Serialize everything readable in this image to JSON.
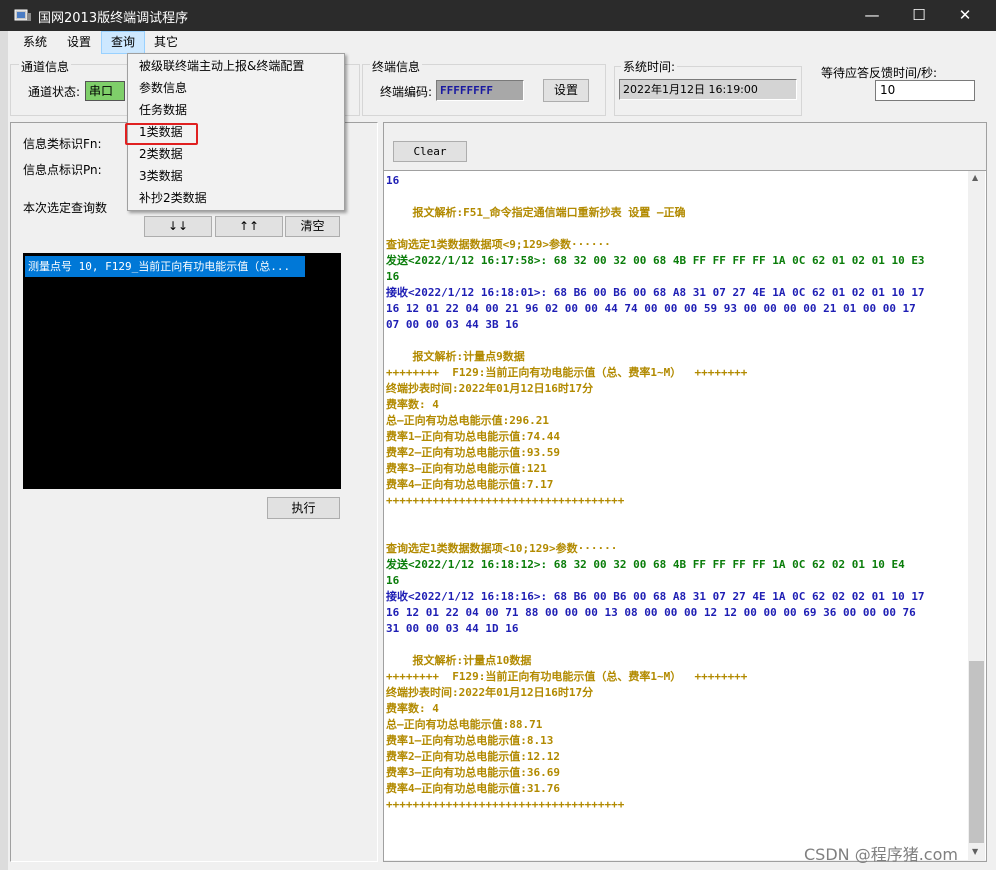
{
  "window": {
    "title": "国网2013版终端调试程序",
    "minimize": "—",
    "maximize": "☐",
    "close": "✕"
  },
  "menu": {
    "items": [
      "系统",
      "设置",
      "查询",
      "其它"
    ],
    "active": "查询",
    "dropdown": [
      "被级联终端主动上报&终端配置",
      "参数信息",
      "任务数据",
      "1类数据",
      "2类数据",
      "3类数据",
      "补抄2类数据"
    ],
    "highlighted": "1类数据"
  },
  "channel": {
    "group_label": "通道信息",
    "status_label": "通道状态:",
    "status_value": "串口"
  },
  "terminal": {
    "group_label": "终端信息",
    "code_label": "终端编码:",
    "code_value": "FFFFFFFF",
    "set_button": "设置"
  },
  "systime": {
    "group_label": "系统时间:",
    "value": "2022年1月12日  16:19:00"
  },
  "wait": {
    "label": "等待应答反馈时间/秒:",
    "value": "10"
  },
  "query": {
    "fn_label": "信息类标识Fn:",
    "pn_label": "信息点标识Pn:",
    "selected_label": "本次选定查询数",
    "btn_down": "↓↓",
    "btn_up": "↑↑",
    "btn_clear": "清空",
    "list_item": "测量点号 10, F129_当前正向有功电能示值（总...",
    "btn_exec": "执行"
  },
  "log": {
    "clear_button": "Clear",
    "lines": [
      {
        "t": "16",
        "c": "blue"
      },
      {
        "t": "",
        "c": "gold"
      },
      {
        "t": "    报文解析:F51_命令指定通信端口重新抄表 设置 —正确",
        "c": "gold"
      },
      {
        "t": "",
        "c": "gold"
      },
      {
        "t": "查询选定1类数据数据项<9;129>参数······",
        "c": "gold"
      },
      {
        "t": "发送<2022/1/12 16:17:58>: 68 32 00 32 00 68 4B FF FF FF FF 1A 0C 62 01 02 01 10 E3",
        "c": "green"
      },
      {
        "t": "16",
        "c": "green"
      },
      {
        "t": "接收<2022/1/12 16:18:01>: 68 B6 00 B6 00 68 A8 31 07 27 4E 1A 0C 62 01 02 01 10 17",
        "c": "blue"
      },
      {
        "t": "16 12 01 22 04 00 21 96 02 00 00 44 74 00 00 00 59 93 00 00 00 00 21 01 00 00 17",
        "c": "blue"
      },
      {
        "t": "07 00 00 03 44 3B 16",
        "c": "blue"
      },
      {
        "t": "",
        "c": "gold"
      },
      {
        "t": "    报文解析:计量点9数据",
        "c": "gold"
      },
      {
        "t": "++++++++  F129:当前正向有功电能示值（总、费率1~M）  ++++++++",
        "c": "gold"
      },
      {
        "t": "终端抄表时间:2022年01月12日16时17分",
        "c": "gold"
      },
      {
        "t": "费率数: 4",
        "c": "gold"
      },
      {
        "t": "总—正向有功总电能示值:296.21",
        "c": "gold"
      },
      {
        "t": "费率1—正向有功总电能示值:74.44",
        "c": "gold"
      },
      {
        "t": "费率2—正向有功总电能示值:93.59",
        "c": "gold"
      },
      {
        "t": "费率3—正向有功总电能示值:121",
        "c": "gold"
      },
      {
        "t": "费率4—正向有功总电能示值:7.17",
        "c": "gold"
      },
      {
        "t": "++++++++++++++++++++++++++++++++++++",
        "c": "gold"
      },
      {
        "t": "",
        "c": "gold"
      },
      {
        "t": "",
        "c": "gold"
      },
      {
        "t": "查询选定1类数据数据项<10;129>参数······",
        "c": "gold"
      },
      {
        "t": "发送<2022/1/12 16:18:12>: 68 32 00 32 00 68 4B FF FF FF FF 1A 0C 62 02 01 10 E4",
        "c": "green"
      },
      {
        "t": "16",
        "c": "green"
      },
      {
        "t": "接收<2022/1/12 16:18:16>: 68 B6 00 B6 00 68 A8 31 07 27 4E 1A 0C 62 02 02 01 10 17",
        "c": "blue"
      },
      {
        "t": "16 12 01 22 04 00 71 88 00 00 00 13 08 00 00 00 12 12 00 00 00 69 36 00 00 00 76",
        "c": "blue"
      },
      {
        "t": "31 00 00 03 44 1D 16",
        "c": "blue"
      },
      {
        "t": "",
        "c": "gold"
      },
      {
        "t": "    报文解析:计量点10数据",
        "c": "gold"
      },
      {
        "t": "++++++++  F129:当前正向有功电能示值（总、费率1~M）  ++++++++",
        "c": "gold"
      },
      {
        "t": "终端抄表时间:2022年01月12日16时17分",
        "c": "gold"
      },
      {
        "t": "费率数: 4",
        "c": "gold"
      },
      {
        "t": "总—正向有功总电能示值:88.71",
        "c": "gold"
      },
      {
        "t": "费率1—正向有功总电能示值:8.13",
        "c": "gold"
      },
      {
        "t": "费率2—正向有功总电能示值:12.12",
        "c": "gold"
      },
      {
        "t": "费率3—正向有功总电能示值:36.69",
        "c": "gold"
      },
      {
        "t": "费率4—正向有功总电能示值:31.76",
        "c": "gold"
      },
      {
        "t": "++++++++++++++++++++++++++++++++++++",
        "c": "gold"
      }
    ]
  },
  "watermark": "CSDN @程序猪.com",
  "colors": {
    "title_bg": "#2b2b2b",
    "list_bg": "#000000",
    "list_selected": "#0078d7",
    "send_text": "#0a7d0a",
    "recv_text": "#1e1eb4",
    "parse_text": "#b28a00",
    "highlight_box": "#e02020"
  }
}
